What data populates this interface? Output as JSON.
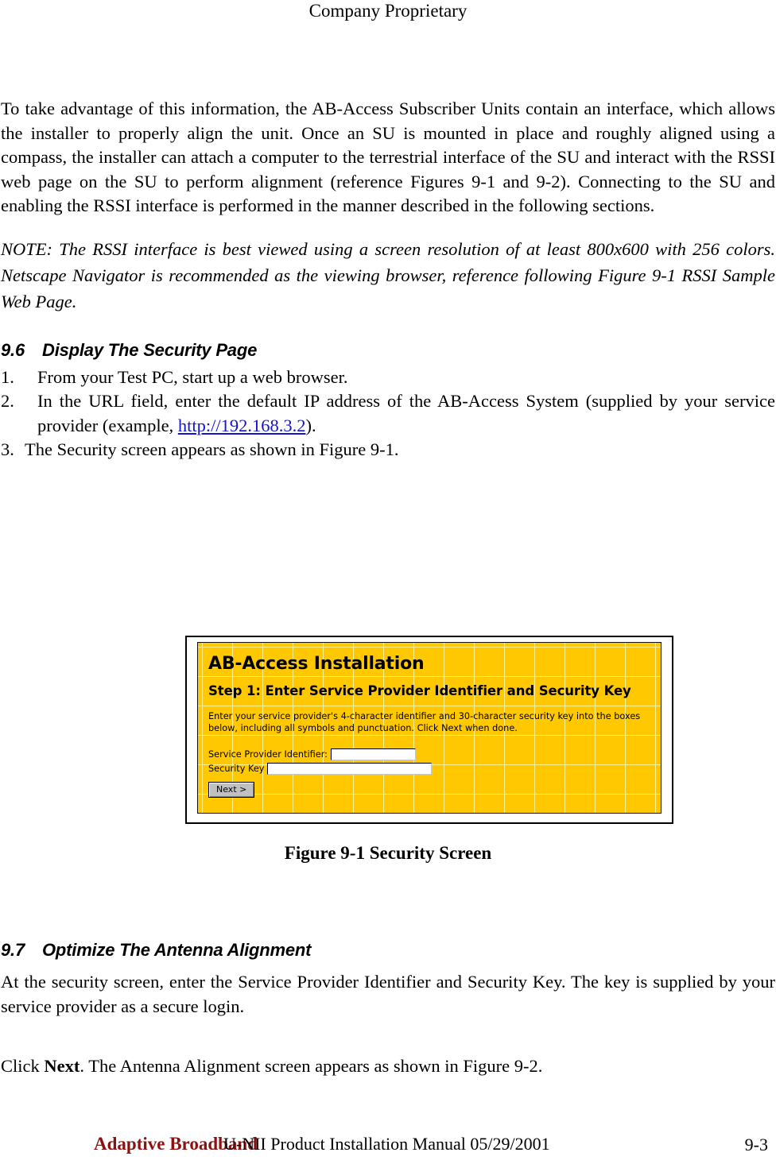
{
  "header": {
    "text": "Company Proprietary"
  },
  "body": {
    "intro_paragraph": "To take advantage of this information, the AB-Access Subscriber Units contain an interface, which allows the installer to properly align the unit.  Once an SU is mounted in place and roughly aligned using a compass, the installer can attach a computer to the terrestrial interface of the SU and interact with the RSSI web page on the SU to perform alignment (reference Figures 9-1 and 9-2).  Connecting to the SU and enabling the RSSI interface is performed in the manner described in the following sections.",
    "note_paragraph": "NOTE: The RSSI interface is best viewed using a screen resolution of at least 800x600 with 256 colors.  Netscape Navigator is recommended as the viewing browser, reference following Figure 9-1 RSSI Sample Web Page."
  },
  "section_96": {
    "number": "9.6",
    "title": "Display The Security Page",
    "steps": [
      {
        "marker": "1.",
        "text": "From your Test PC, start up a web browser."
      },
      {
        "marker": "2.",
        "text_before": "In the URL field, enter the default IP address of the AB-Access System (supplied by your service provider (example,  ",
        "link": "http://192.168.3.2",
        "text_after": ")."
      },
      {
        "marker": "3.",
        "text": "The Security screen appears as shown in Figure 9-1."
      }
    ]
  },
  "figure": {
    "caption": "Figure 9-1  Security Screen",
    "screen": {
      "title": "AB-Access Installation",
      "step_heading": "Step 1: Enter Service Provider Identifier and Security Key",
      "instructions": "Enter your service provider's 4-character identifier and 30-character security key into the boxes below, including all symbols and punctuation. Click Next when done.",
      "field_spid_label": "Service Provider Identifier:",
      "field_spid_value": "",
      "field_key_label": "Security Key",
      "field_key_value": "",
      "next_button_label": "Next >",
      "background_color": "#ffc800",
      "plus_mark_color": "#fff096"
    }
  },
  "section_97": {
    "number": "9.7",
    "title": "Optimize The Antenna Alignment",
    "paragraph": "At the security screen, enter the Service Provider Identifier and Security Key.  The key is supplied by your  service provider as a secure login."
  },
  "click_next": {
    "prefix": "Click ",
    "bold": "Next",
    "suffix": ".  The Antenna Alignment screen appears as shown in Figure 9-2."
  },
  "footer": {
    "brand": "Adaptive Broadband",
    "brand_color": "#8c1212",
    "manual": "U-NII Product Installation Manual  05/29/2001",
    "page_number": "9-3"
  }
}
